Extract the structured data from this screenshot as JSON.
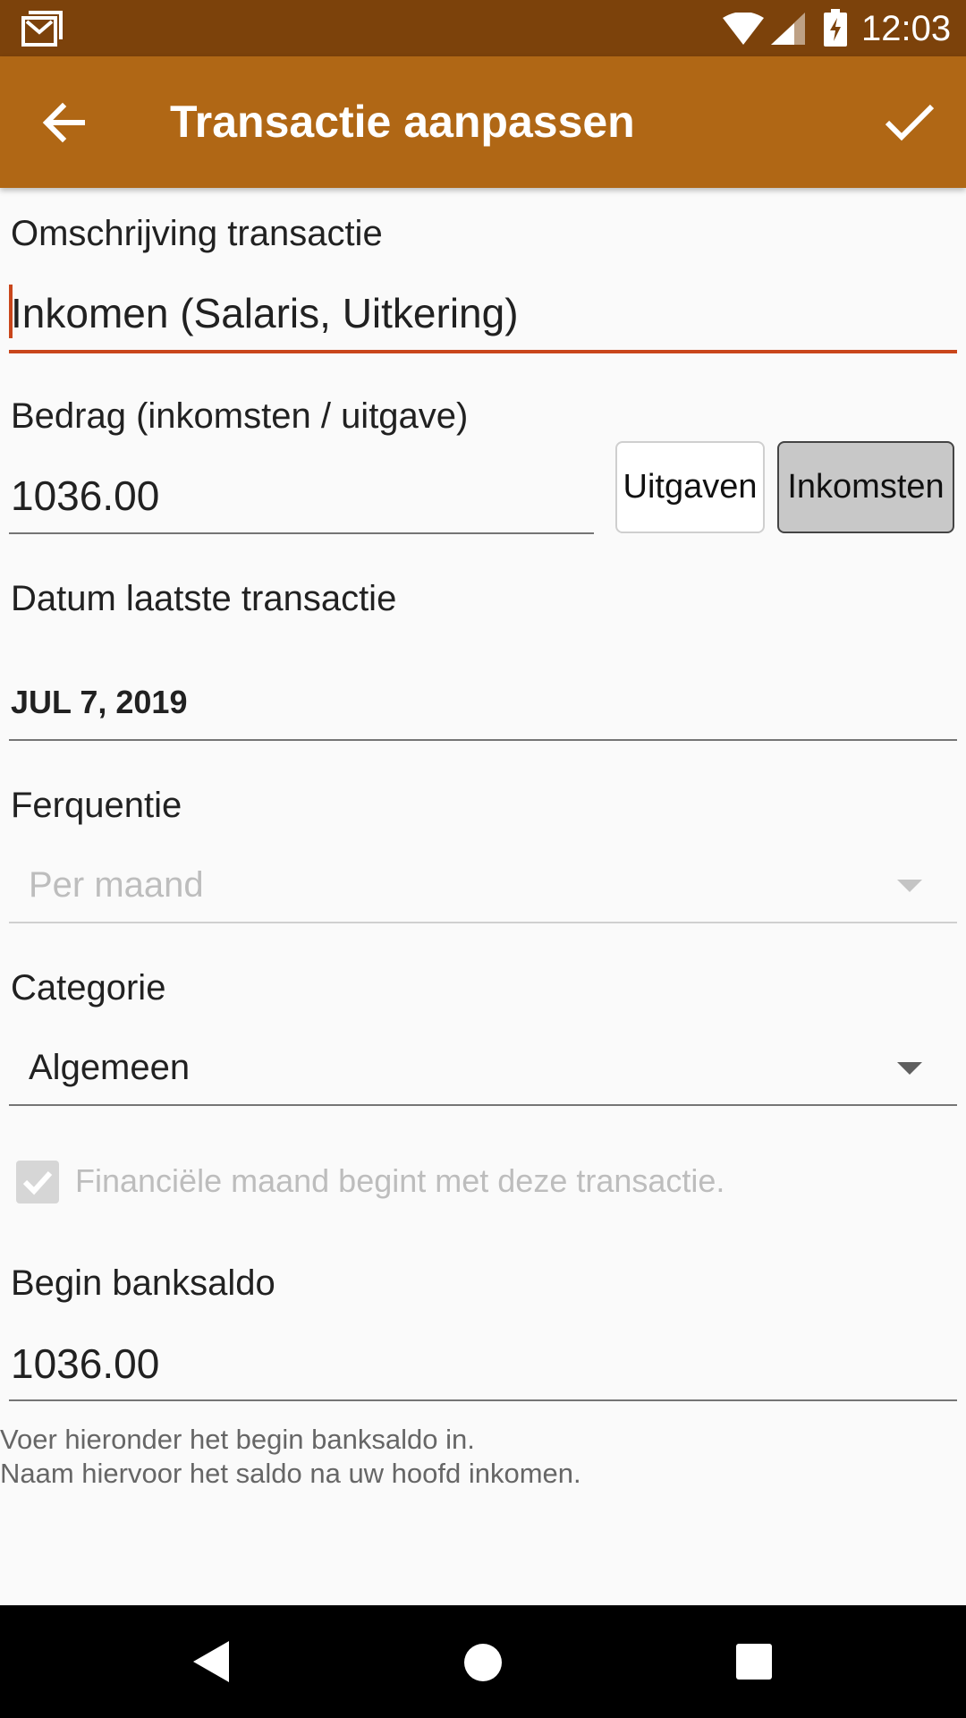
{
  "status_bar": {
    "time": "12:03",
    "icons": [
      "gmail-icon",
      "wifi-icon",
      "signal-icon",
      "battery-charging-icon"
    ]
  },
  "toolbar": {
    "title": "Transactie aanpassen",
    "back_icon": "arrow-back-icon",
    "confirm_icon": "check-icon",
    "color": "#b06715"
  },
  "form": {
    "description": {
      "label": "Omschrijving transactie",
      "value": "Inkomen (Salaris, Uitkering)",
      "accent": "#c9461b"
    },
    "amount": {
      "label": "Bedrag (inkomsten / uitgave)",
      "value": "1036.00",
      "toggle_expense": "Uitgaven",
      "toggle_income": "Inkomsten",
      "selected": "Inkomsten"
    },
    "date": {
      "label": "Datum laatste transactie",
      "value": "JUL 7, 2019"
    },
    "frequency": {
      "label": "Ferquentie",
      "value": "Per maand",
      "disabled": true
    },
    "category": {
      "label": "Categorie",
      "value": "Algemeen"
    },
    "financial_month": {
      "label": "Financiële maand begint met deze transactie.",
      "checked": true,
      "disabled": true
    },
    "start_balance": {
      "label": "Begin banksaldo",
      "value": "1036.00",
      "hint_line1": "Voer hieronder het begin banksaldo in.",
      "hint_line2": "Naam hiervoor het saldo na uw hoofd inkomen."
    }
  },
  "navbar": {
    "icons": [
      "back-triangle-icon",
      "home-circle-icon",
      "recents-square-icon"
    ]
  }
}
